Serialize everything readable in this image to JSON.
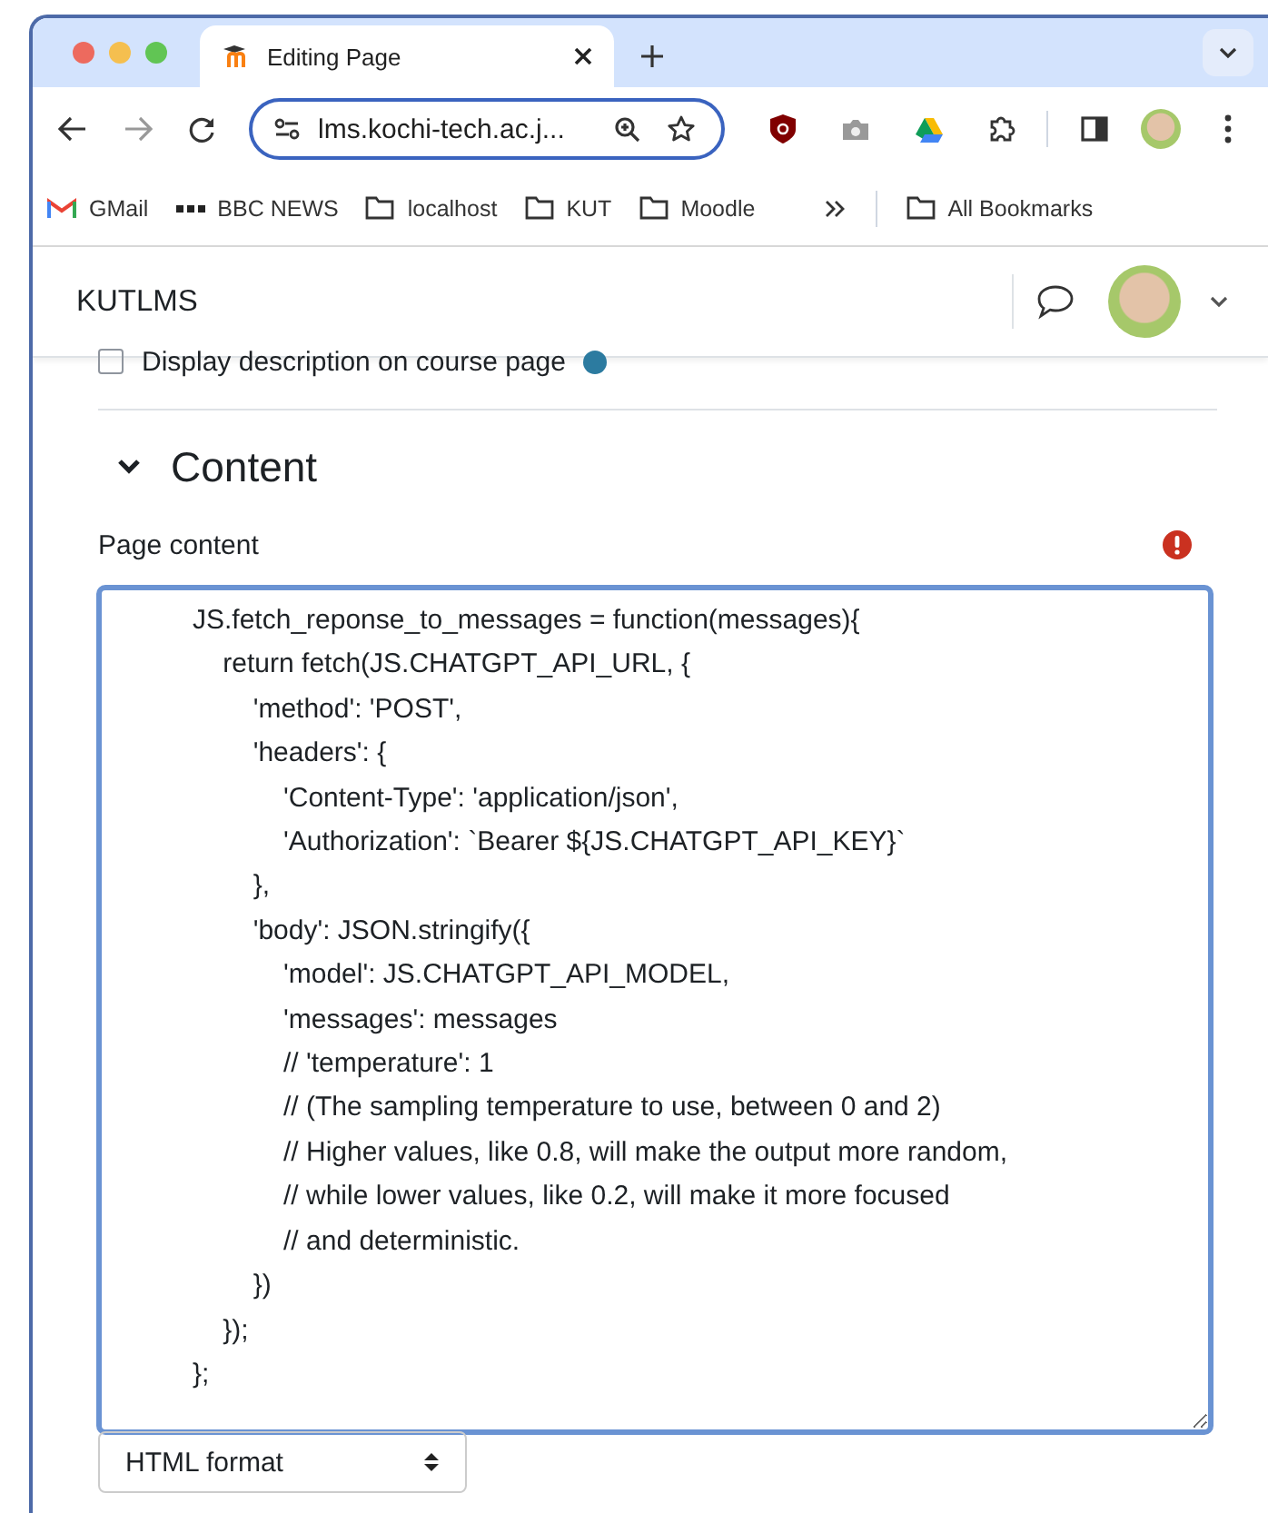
{
  "browser": {
    "tabs": [
      {
        "title": "Editing Page",
        "selected": true
      }
    ],
    "address": "lms.kochi-tech.ac.j...",
    "bookmarks": [
      {
        "label": "GMail",
        "kind": "gmail"
      },
      {
        "label": "BBC NEWS",
        "kind": "dots"
      },
      {
        "label": "localhost",
        "kind": "folder"
      },
      {
        "label": "KUT",
        "kind": "folder"
      },
      {
        "label": "Moodle",
        "kind": "folder"
      }
    ],
    "all_bookmarks": "All Bookmarks"
  },
  "site": {
    "name": "KUTLMS"
  },
  "form": {
    "checkbox": {
      "label": "Display description on course page",
      "checked": false
    },
    "section": {
      "title": "Content",
      "expanded": true
    },
    "field": {
      "label": "Page content",
      "error": true,
      "value": "JS.fetch_reponse_to_messages = function(messages){\n    return fetch(JS.CHATGPT_API_URL, {\n        'method': 'POST',\n        'headers': {\n            'Content-Type': 'application/json',\n            'Authorization': `Bearer ${JS.CHATGPT_API_KEY}`\n        },\n        'body': JSON.stringify({\n            'model': JS.CHATGPT_API_MODEL,\n            'messages': messages\n            // 'temperature': 1\n            // (The sampling temperature to use, between 0 and 2)\n            // Higher values, like 0.8, will make the output more random,\n            // while lower values, like 0.2, will make it more focused\n            // and deterministic.\n        })\n    });\n};"
    },
    "format_select": {
      "value": "HTML format"
    }
  }
}
